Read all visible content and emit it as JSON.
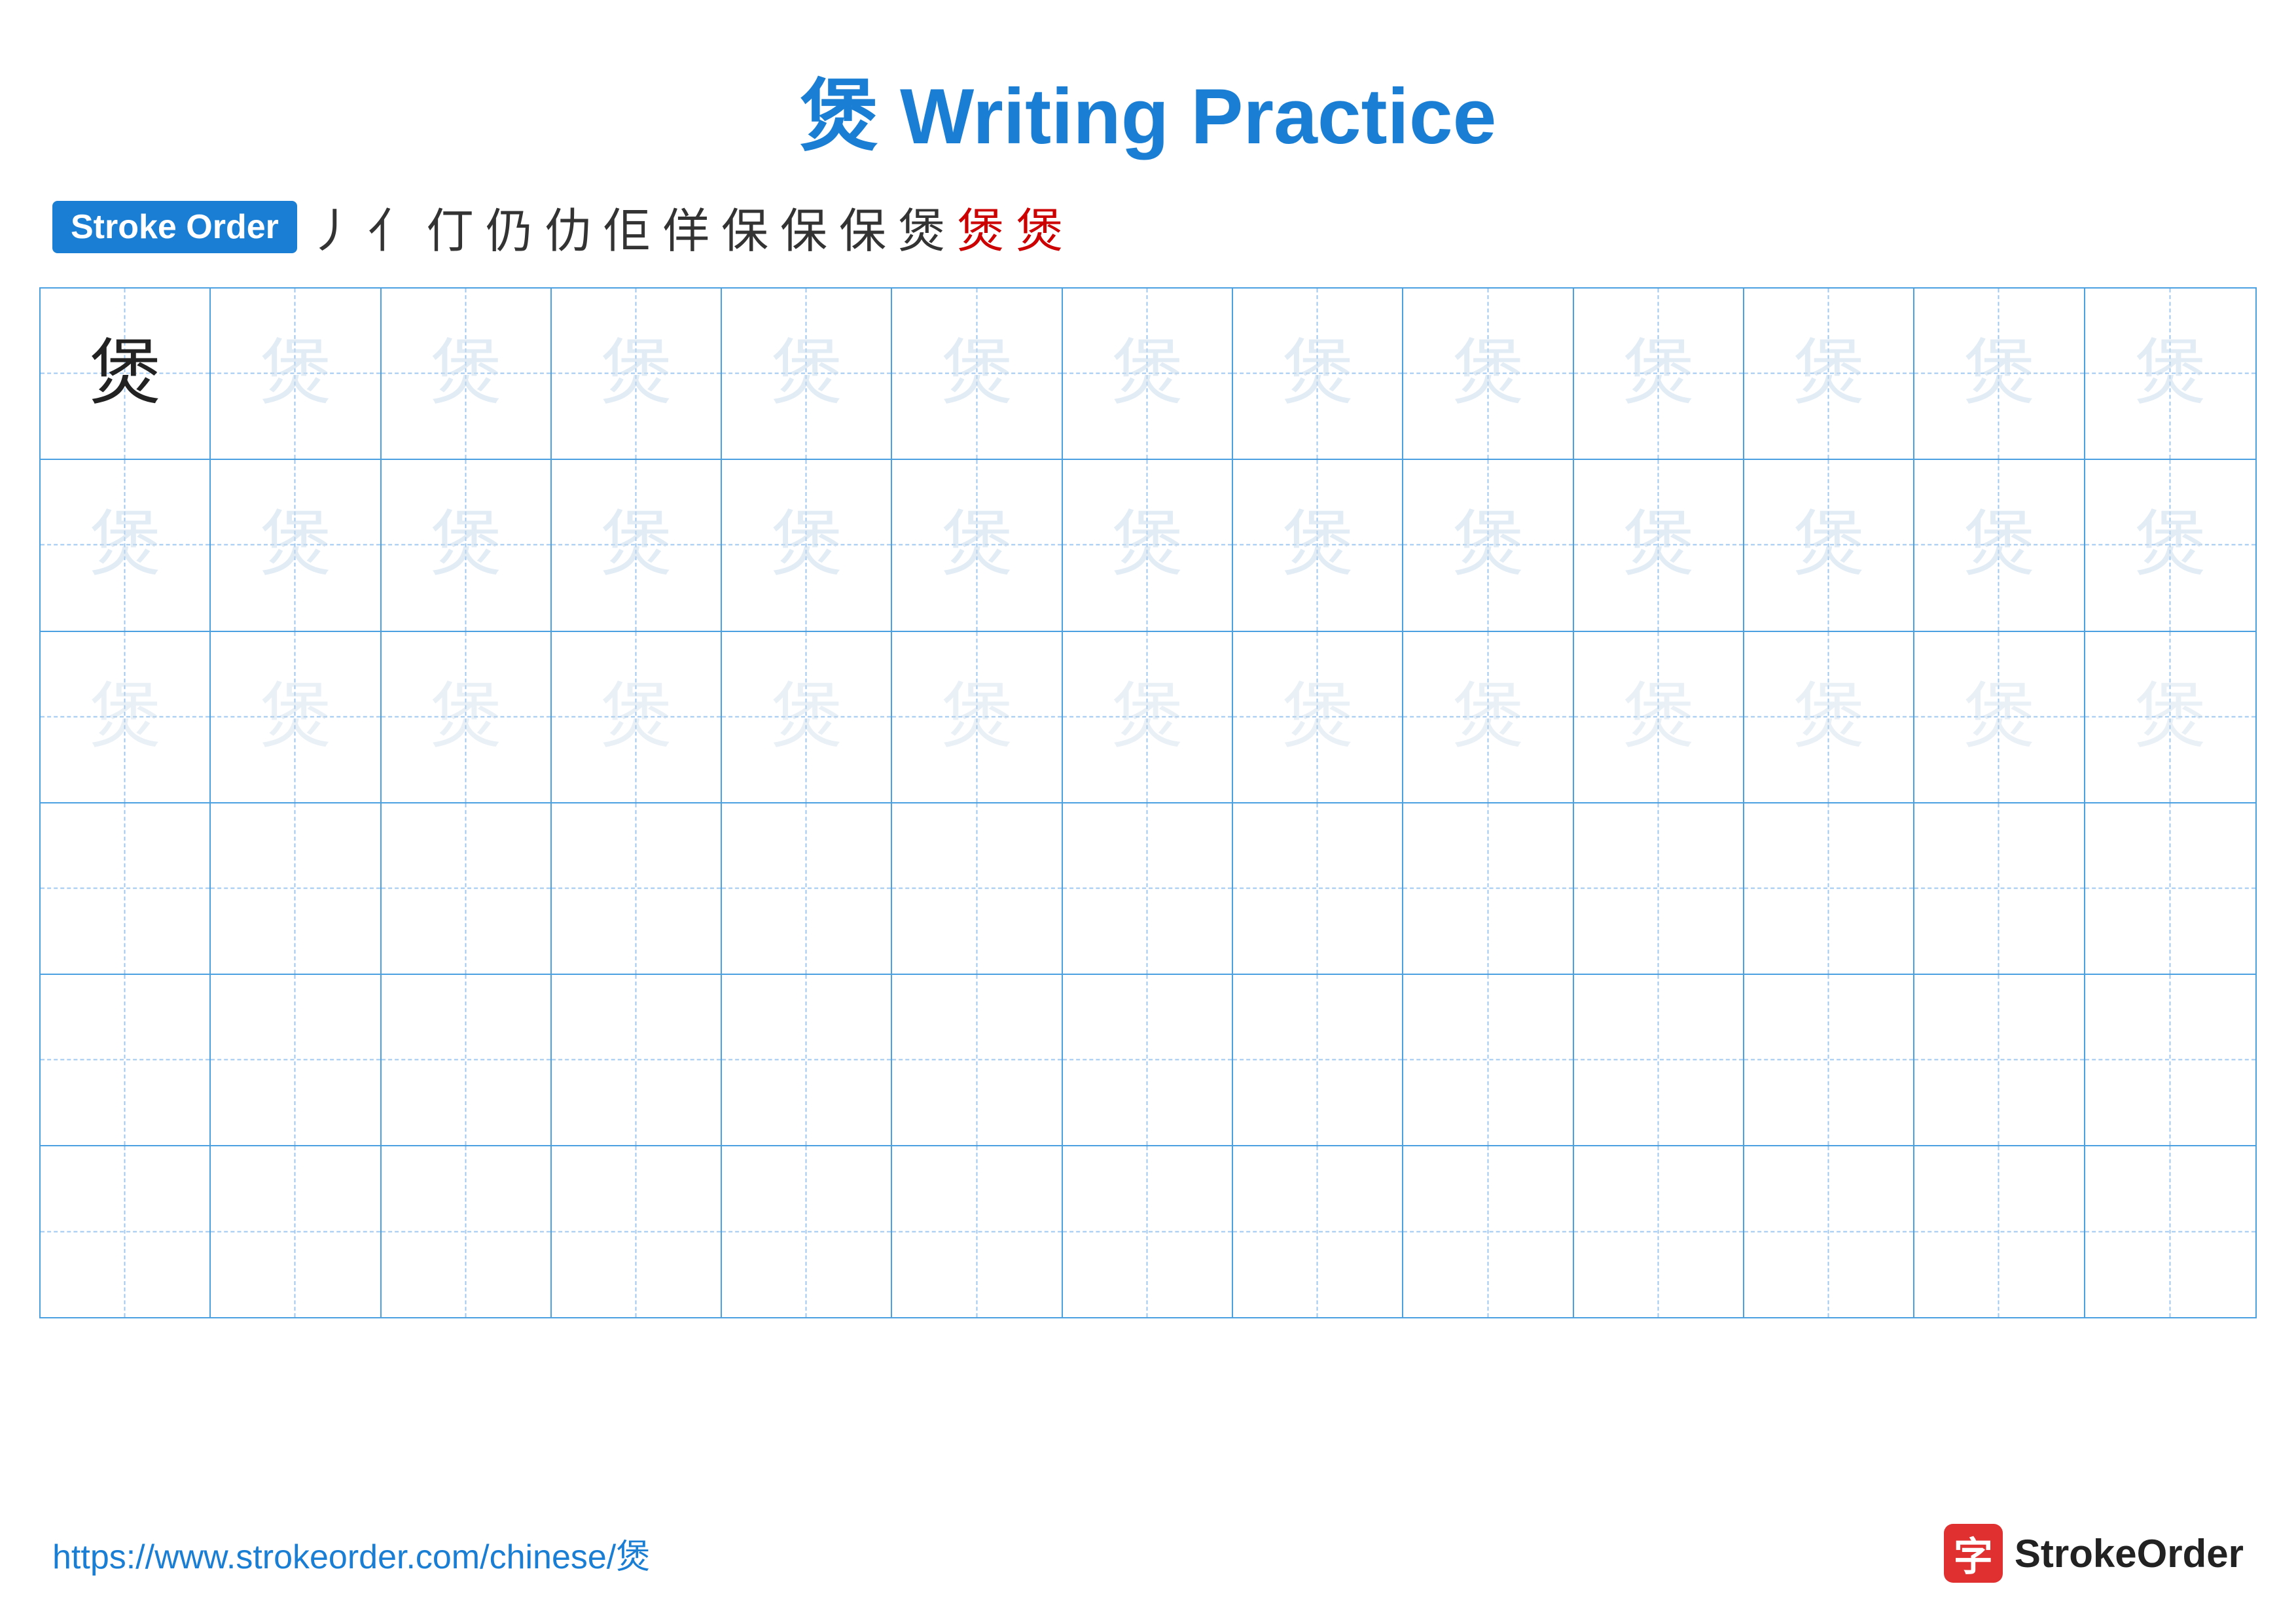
{
  "title": {
    "chinese_char": "煲",
    "text": "煲 Writing Practice"
  },
  "stroke_order": {
    "badge_label": "Stroke Order",
    "strokes": [
      "丿",
      "亻",
      "仃",
      "仍",
      "仂",
      "佢",
      "佯",
      "保",
      "保",
      "保",
      "煲",
      "煲",
      "煲"
    ]
  },
  "grid": {
    "rows": 6,
    "cols": 13,
    "practice_char": "煲",
    "row_types": [
      "dark+light",
      "light",
      "lighter",
      "empty",
      "empty",
      "empty"
    ]
  },
  "footer": {
    "url": "https://www.strokeorder.com/chinese/煲",
    "logo_icon": "字",
    "logo_text": "StrokeOrder"
  }
}
